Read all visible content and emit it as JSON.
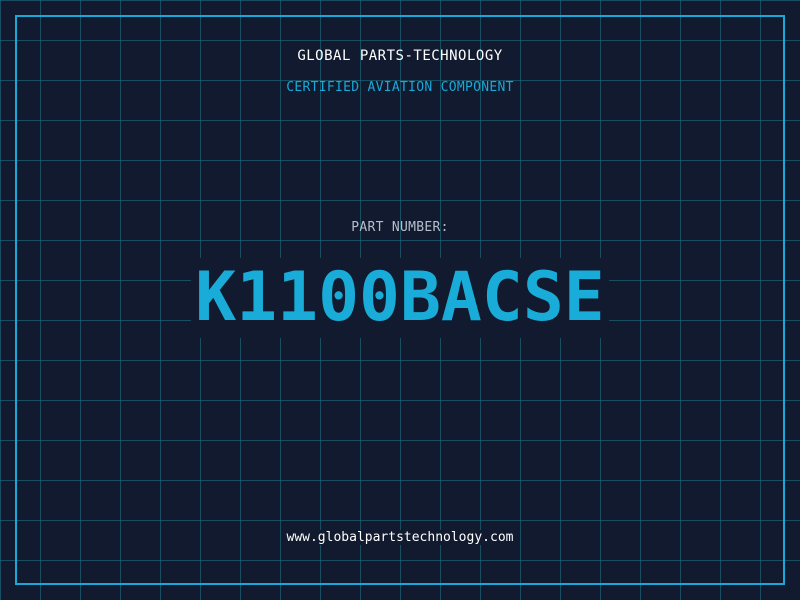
{
  "header": {
    "brand": "GLOBAL PARTS-TECHNOLOGY",
    "subtitle": "CERTIFIED AVIATION COMPONENT"
  },
  "part": {
    "label": "PART NUMBER:",
    "number": "K1100BACSE"
  },
  "footer": {
    "url": "www.globalpartstechnology.com"
  },
  "colors": {
    "background": "#111a2e",
    "grid": "#1e788c",
    "accent": "#18a9d8",
    "text_primary": "#ffffff",
    "text_muted": "#b7bfcc"
  }
}
